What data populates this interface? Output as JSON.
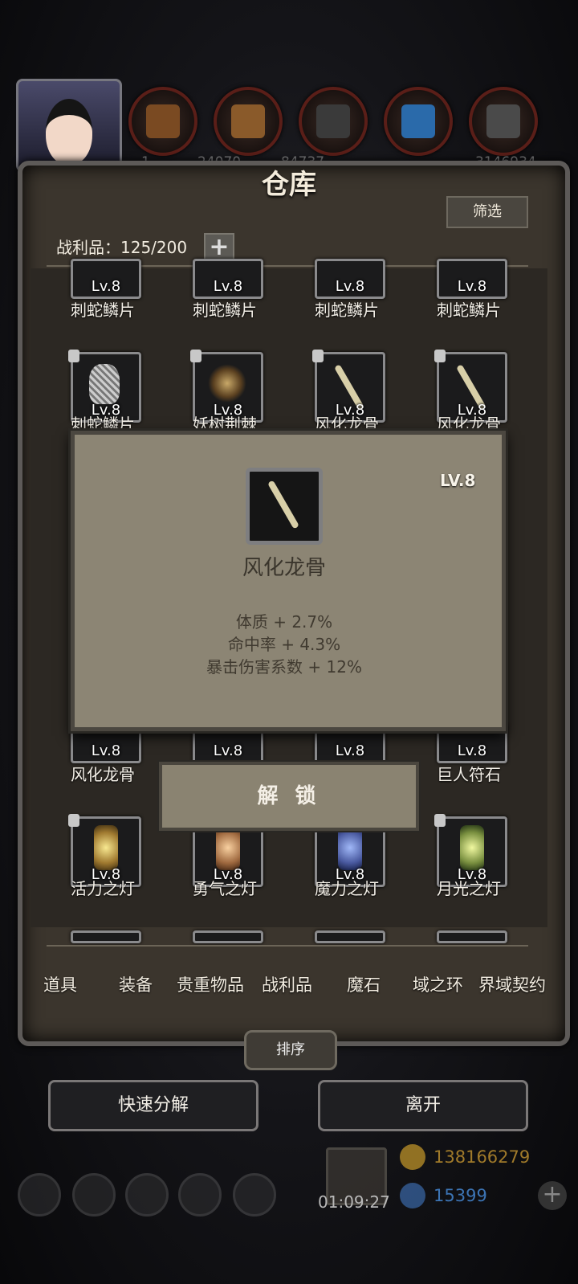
{
  "header": {
    "resource_numbers": [
      "1",
      "24070",
      "84737",
      "3146934"
    ]
  },
  "panel": {
    "title": "仓库",
    "filter_label": "筛选",
    "capacity_label": "战利品：125/200",
    "plus_label": "+"
  },
  "grid": {
    "rows": [
      {
        "items": [
          {
            "level": "Lv.8",
            "name": "刺蛇鳞片",
            "icon": "scale-icon"
          },
          {
            "level": "Lv.8",
            "name": "刺蛇鳞片",
            "icon": "scale-icon"
          },
          {
            "level": "Lv.8",
            "name": "刺蛇鳞片",
            "icon": "scale-icon"
          },
          {
            "level": "Lv.8",
            "name": "刺蛇鳞片",
            "icon": "scale-icon"
          }
        ]
      },
      {
        "items": [
          {
            "level": "Lv.8",
            "name": "刺蛇鳞片",
            "icon": "scale-icon"
          },
          {
            "level": "Lv.8",
            "name": "妖树荆棘",
            "icon": "thorn-icon"
          },
          {
            "level": "Lv.8",
            "name": "风化龙骨",
            "icon": "bone-icon"
          },
          {
            "level": "Lv.8",
            "name": "风化龙骨",
            "icon": "bone-icon"
          }
        ]
      },
      {
        "items": [
          {
            "level": "Lv.8",
            "name": "风化龙骨",
            "icon": "bone-icon"
          },
          {
            "level": "Lv.8",
            "name": "",
            "icon": "bone-icon"
          },
          {
            "level": "Lv.8",
            "name": "",
            "icon": "rune-icon"
          },
          {
            "level": "Lv.8",
            "name": "巨人符石",
            "icon": "rune-icon"
          }
        ]
      },
      {
        "items": [
          {
            "level": "Lv.8",
            "name": "活力之灯",
            "icon": "lamp-icon"
          },
          {
            "level": "Lv.8",
            "name": "勇气之灯",
            "icon": "lamp-icon"
          },
          {
            "level": "Lv.8",
            "name": "魔力之灯",
            "icon": "lamp-icon"
          },
          {
            "level": "Lv.8",
            "name": "月光之灯",
            "icon": "lamp-icon"
          }
        ]
      }
    ]
  },
  "popup": {
    "level": "LV.8",
    "name": "风化龙骨",
    "stats": [
      "体质 + 2.7%",
      "命中率 + 4.3%",
      "暴击伤害系数 + 12%"
    ],
    "unlock_label": "解 锁"
  },
  "tabs": [
    "道具",
    "装备",
    "贵重物品",
    "战利品",
    "魔石",
    "域之环",
    "界域契约"
  ],
  "actions": {
    "sort_label": "排序",
    "decompose_label": "快速分解",
    "leave_label": "离开"
  },
  "footer": {
    "timer": "01:09:27",
    "gold": "138166279",
    "gems": "15399"
  },
  "colors": {
    "panel_bg": "#3b352d",
    "popup_bg": "#8c8574",
    "gold_text": "#a07a2a",
    "gem_text": "#3c74b4"
  }
}
